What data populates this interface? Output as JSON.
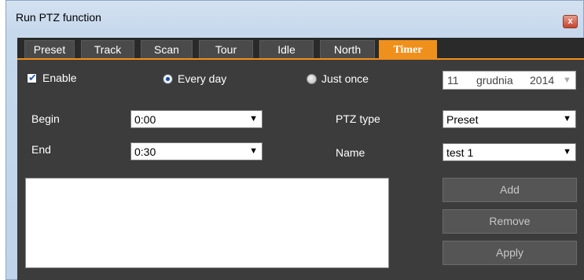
{
  "window": {
    "title": "Run PTZ function",
    "close_glyph": "x"
  },
  "tabs": [
    {
      "label": "Preset"
    },
    {
      "label": "Track"
    },
    {
      "label": "Scan"
    },
    {
      "label": "Tour"
    },
    {
      "label": "Idle"
    },
    {
      "label": "North"
    },
    {
      "label": "Timer",
      "active": true
    }
  ],
  "schedule": {
    "enable_label": "Enable",
    "enable_checked": true,
    "every_day_label": "Every day",
    "just_once_label": "Just once",
    "selected_mode": "Every day",
    "date": {
      "day": "11",
      "month": "grudnia",
      "year": "2014"
    }
  },
  "time": {
    "begin_label": "Begin",
    "begin_value": "0:00",
    "end_label": "End",
    "end_value": "0:30"
  },
  "ptz": {
    "type_label": "PTZ type",
    "type_value": "Preset",
    "name_label": "Name",
    "name_value": "test 1"
  },
  "buttons": {
    "add": "Add",
    "remove": "Remove",
    "apply": "Apply"
  },
  "icons": {
    "dropdown": "chevron-down-icon",
    "checkmark": "check-icon",
    "close": "close-icon"
  },
  "colors": {
    "accent": "#f0901c",
    "panel": "#3c3c3c",
    "button": "#555555"
  }
}
